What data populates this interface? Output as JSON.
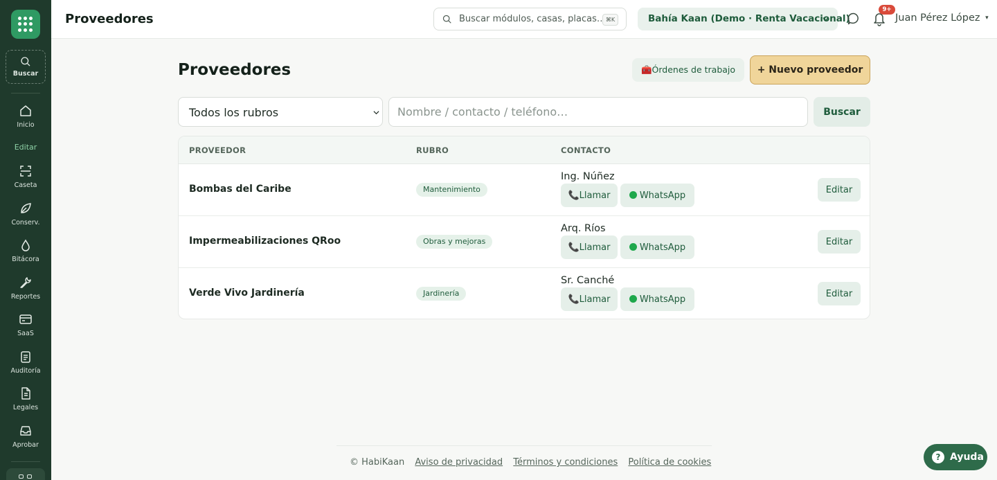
{
  "sidebar": {
    "search_label": "Buscar",
    "items": [
      {
        "label": "Inicio",
        "icon": "home-icon"
      },
      {
        "label": "Caseta",
        "icon": "scan-icon"
      },
      {
        "label": "Conserv.",
        "icon": "leaf-icon"
      },
      {
        "label": "Bitácora",
        "icon": "drop-icon"
      },
      {
        "label": "Reportes",
        "icon": "wrench-icon"
      },
      {
        "label": "SaaS",
        "icon": "card-icon"
      },
      {
        "label": "Auditoría",
        "icon": "clipboard-icon"
      },
      {
        "label": "Legales",
        "icon": "document-icon"
      },
      {
        "label": "Aprobar",
        "icon": "inbox-icon"
      }
    ],
    "section_edit": "Editar"
  },
  "header": {
    "title": "Proveedores",
    "search_placeholder": "Buscar módulos, casas, placas…",
    "shortcut": "⌘K",
    "tenant": "Bahía Kaan (Demo · Renta Vacacional)",
    "notifications": "9+",
    "user": "Juan Pérez López"
  },
  "main": {
    "title": "Proveedores",
    "orders_button": "🧰Órdenes de trabajo",
    "new_button": "+ Nuevo proveedor",
    "filter_value": "Todos los rubros",
    "search_placeholder": "Nombre / contacto / teléfono…",
    "search_button": "Buscar",
    "columns": [
      "PROVEEDOR",
      "RUBRO",
      "CONTACTO"
    ],
    "rows": [
      {
        "name": "Bombas del Caribe",
        "rubro": "Mantenimiento",
        "contact": "Ing. Núñez"
      },
      {
        "name": "Impermeabilizaciones QRoo",
        "rubro": "Obras y mejoras",
        "contact": "Arq. Ríos"
      },
      {
        "name": "Verde Vivo Jardinería",
        "rubro": "Jardinería",
        "contact": "Sr. Canché"
      }
    ],
    "call_label": "📞Llamar",
    "whatsapp_label": "WhatsApp",
    "edit_label": "Editar"
  },
  "footer": {
    "copyright": "© HabiKaan",
    "privacy": "Aviso de privacidad",
    "terms": "Términos y condiciones",
    "cookies": "Política de cookies"
  },
  "help_label": "Ayuda",
  "colors": {
    "sidebar": "#1f3a2c",
    "accent": "#2f9a63",
    "primary_button": "#f0d59a",
    "badge": "#d94a3a"
  }
}
